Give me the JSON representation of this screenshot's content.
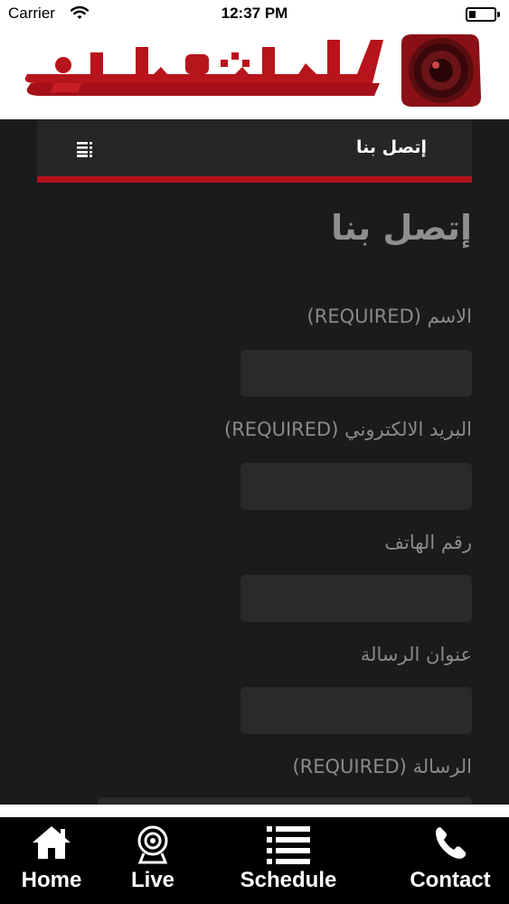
{
  "status_bar": {
    "carrier": "Carrier",
    "time": "12:37 PM",
    "battery_level": 0.25
  },
  "header": {
    "logo_text": "الشاهد"
  },
  "navbar": {
    "title": "إتصل بنا"
  },
  "page": {
    "title": "إتصل بنا"
  },
  "form": {
    "fields": [
      {
        "label": "الاسم (REQUIRED)",
        "value": ""
      },
      {
        "label": "البريد الالكتروني (REQUIRED)",
        "value": ""
      },
      {
        "label": "رقم الهاتف",
        "value": ""
      },
      {
        "label": "عنوان الرسالة",
        "value": ""
      },
      {
        "label": "الرسالة (REQUIRED)",
        "value": ""
      }
    ]
  },
  "tab_bar": {
    "tabs": [
      {
        "label": "Home",
        "icon": "home-icon"
      },
      {
        "label": "Live",
        "icon": "webcam-icon"
      },
      {
        "label": "Schedule",
        "icon": "list-icon"
      },
      {
        "label": "Contact",
        "icon": "phone-icon"
      }
    ]
  },
  "colors": {
    "accent": "#b3121b",
    "background": "#1b1a1c",
    "navbar": "#262527"
  }
}
